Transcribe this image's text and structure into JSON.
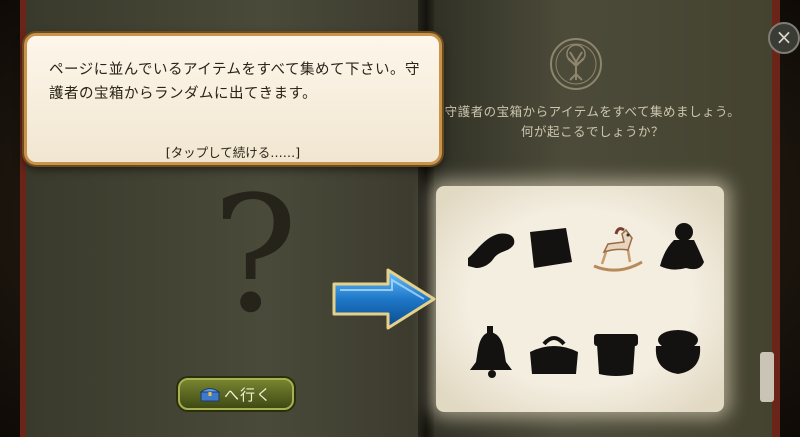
{
  "tooltip": {
    "text": "ページに並んでいるアイテムをすべて集めて下さい。守護者の宝箱からランダムに出てきます。",
    "continue": "[タップして続ける……]"
  },
  "right_page": {
    "hint": "守護者の宝箱からアイテムをすべて集めましょう。何が起こるでしょうか？"
  },
  "left_page": {
    "unknown_symbol": "?"
  },
  "go_button": {
    "label": "へ行く",
    "icon": "chest-icon"
  },
  "items": [
    {
      "name": "horn-silhouette",
      "collected": false
    },
    {
      "name": "book-silhouette",
      "collected": false
    },
    {
      "name": "rocking-horse",
      "collected": true
    },
    {
      "name": "doll-silhouette",
      "collected": false
    },
    {
      "name": "bell-silhouette",
      "collected": false
    },
    {
      "name": "bag-silhouette",
      "collected": false
    },
    {
      "name": "hatbox-silhouette",
      "collected": false
    },
    {
      "name": "pot-silhouette",
      "collected": false
    }
  ],
  "close_icon": "×",
  "tab_icon": "chevron-down-icon",
  "colors": {
    "arrow": "#2f8fd6",
    "button": "#5c6a22",
    "tooltip_border": "#c8934a"
  }
}
